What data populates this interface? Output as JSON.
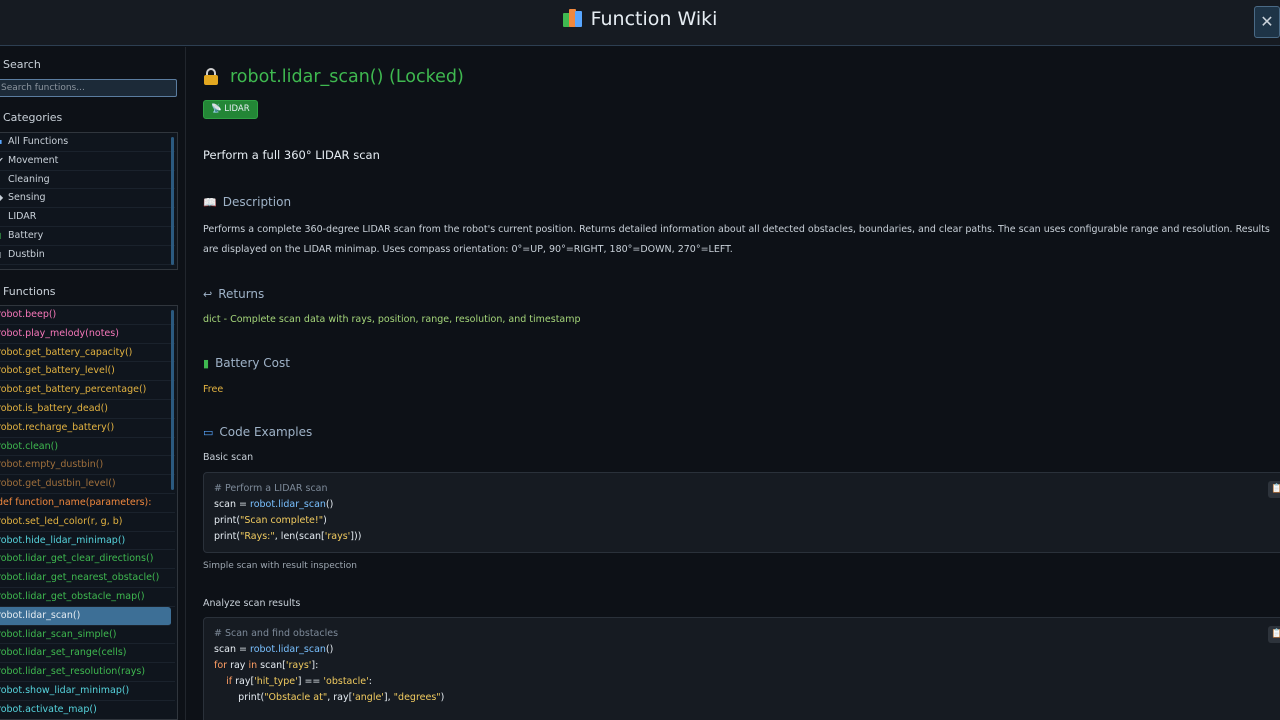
{
  "header": {
    "title": "Function Wiki",
    "close_label": "✕"
  },
  "sidebar": {
    "search_title": "Search",
    "search_placeholder": "Search functions...",
    "categories_title": "Categories",
    "categories": [
      {
        "icon": "▪",
        "label": "All Functions"
      },
      {
        "icon": "✔",
        "label": "Movement"
      },
      {
        "icon": "",
        "label": "Cleaning"
      },
      {
        "icon": "◆",
        "label": "Sensing"
      },
      {
        "icon": "",
        "label": "LIDAR"
      },
      {
        "icon": "▮",
        "label": "Battery"
      },
      {
        "icon": "▯",
        "label": "Dustbin"
      }
    ],
    "functions_title": "Functions",
    "functions": [
      {
        "label": "robot.beep()",
        "color": "#f778ba"
      },
      {
        "label": "robot.play_melody(notes)",
        "color": "#f778ba"
      },
      {
        "label": "robot.get_battery_capacity()",
        "color": "#e3b341"
      },
      {
        "label": "robot.get_battery_level()",
        "color": "#e3b341"
      },
      {
        "label": "robot.get_battery_percentage()",
        "color": "#e3b341"
      },
      {
        "label": "robot.is_battery_dead()",
        "color": "#e3b341"
      },
      {
        "label": "robot.recharge_battery()",
        "color": "#e3b341"
      },
      {
        "label": "robot.clean()",
        "color": "#3fb950"
      },
      {
        "label": "robot.empty_dustbin()",
        "color": "#a0703c"
      },
      {
        "label": "robot.get_dustbin_level()",
        "color": "#a0703c"
      },
      {
        "label": "def function_name(parameters):",
        "color": "#f0883e"
      },
      {
        "label": "robot.set_led_color(r, g, b)",
        "color": "#e3b341"
      },
      {
        "label": "robot.hide_lidar_minimap()",
        "color": "#56d4dd"
      },
      {
        "label": "robot.lidar_get_clear_directions()",
        "color": "#3fb950"
      },
      {
        "label": "robot.lidar_get_nearest_obstacle()",
        "color": "#3fb950"
      },
      {
        "label": "robot.lidar_get_obstacle_map()",
        "color": "#3fb950"
      },
      {
        "label": "robot.lidar_scan()",
        "color": "#e6edf3",
        "selected": true
      },
      {
        "label": "robot.lidar_scan_simple()",
        "color": "#3fb950"
      },
      {
        "label": "robot.lidar_set_range(cells)",
        "color": "#3fb950"
      },
      {
        "label": "robot.lidar_set_resolution(rays)",
        "color": "#3fb950"
      },
      {
        "label": "robot.show_lidar_minimap()",
        "color": "#56d4dd"
      },
      {
        "label": "robot.activate_map()",
        "color": "#56d4dd"
      }
    ]
  },
  "main": {
    "title": "robot.lidar_scan()  (Locked)",
    "badge": "📡 LIDAR",
    "summary": "Perform a full 360° LIDAR scan",
    "description_title": "Description",
    "description": "Performs a complete 360-degree LIDAR scan from the robot's current position. Returns detailed information about all detected obstacles, boundaries, and clear paths. The scan uses configurable range and resolution. Results are displayed on the LIDAR minimap. Uses compass orientation: 0°=UP, 90°=RIGHT, 180°=DOWN, 270°=LEFT.",
    "returns_title": "Returns",
    "returns": "dict - Complete scan data with rays, position, range, resolution, and timestamp",
    "cost_title": "Battery Cost",
    "cost": "Free",
    "examples_title": "Code Examples",
    "examples": [
      {
        "label": "Basic scan",
        "note": "Simple scan with result inspection",
        "lines": [
          "# Perform a LIDAR scan",
          "scan = robot.lidar_scan()",
          "print(\"Scan complete!\")",
          "print(\"Rays:\", len(scan['rays']))"
        ]
      },
      {
        "label": "Analyze scan results",
        "lines": [
          "# Scan and find obstacles",
          "scan = robot.lidar_scan()",
          "for ray in scan['rays']:",
          "    if ray['hit_type'] == 'obstacle':",
          "        print(\"Obstacle at\", ray['angle'], \"degrees\")"
        ]
      }
    ],
    "copy_icon": "📋"
  }
}
